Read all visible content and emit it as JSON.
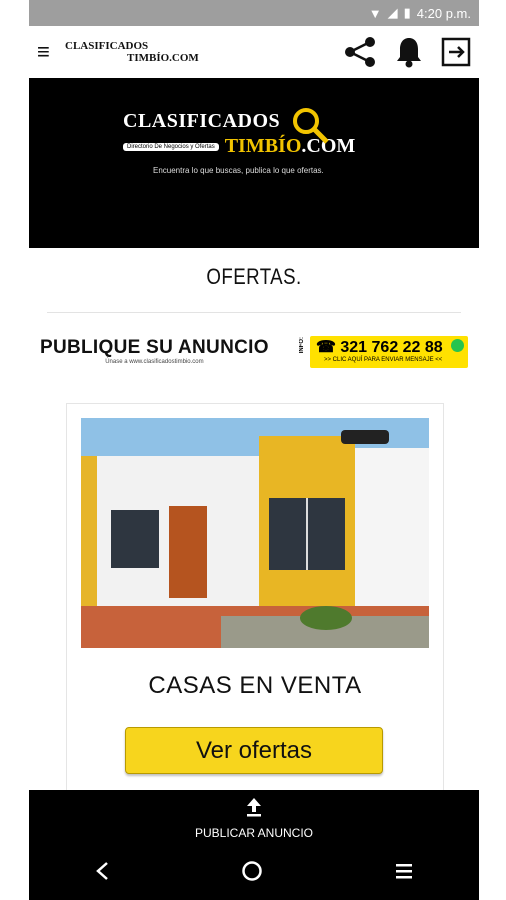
{
  "status_bar": {
    "time": "4:20 p.m."
  },
  "app_bar": {
    "logo_line1": "CLASIFICADOS",
    "logo_line2": "TIMBÍO.COM",
    "icons": [
      "menu-icon",
      "share-icon",
      "bell-icon",
      "logout-icon"
    ]
  },
  "hero": {
    "title": "CLASIFICADOS",
    "directorio": "Directorio De Negocios y Ofertas",
    "timbio": "TIMBÍO",
    "com": ".COM",
    "tagline": "Encuentra lo que buscas, publica lo que ofertas."
  },
  "page": {
    "title": "OFERTAS."
  },
  "banner": {
    "headline": "PUBLIQUE SU ANUNCIO",
    "url": "Únase a www.clasificadostimbio.com",
    "info_label": "INFO:",
    "phone": "☎ 321 762 22 88",
    "click_text": ">> CLIC AQUÍ PARA ENVIAR MENSAJE <<"
  },
  "card": {
    "title": "CASAS EN VENTA",
    "button_label": "Ver ofertas"
  },
  "bottom_bar": {
    "publish_label": "PUBLICAR ANUNCIO"
  },
  "colors": {
    "brand_yellow": "#f7d51d",
    "header_bg": "#000000"
  }
}
